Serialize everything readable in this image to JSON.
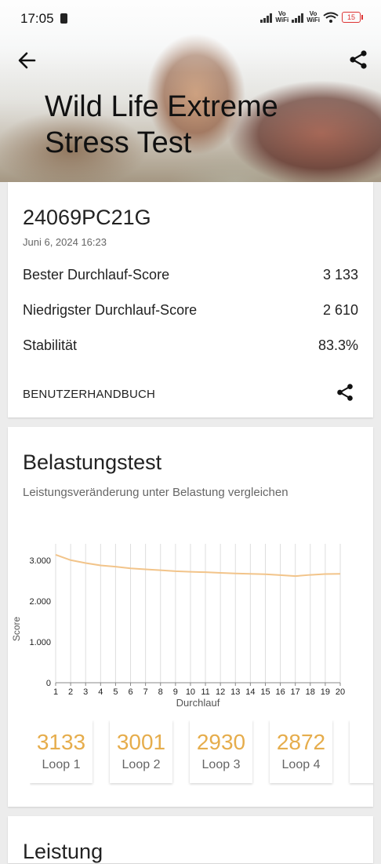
{
  "status": {
    "time": "17:05",
    "vo1": "Vo",
    "wifi1": "WiFi",
    "vo2": "Vo",
    "wifi2": "WiFi",
    "battery": "15"
  },
  "header": {
    "title": "Wild Life Extreme Stress Test"
  },
  "summary": {
    "device": "24069PC21G",
    "date": "Juni 6, 2024 16:23",
    "rows": [
      {
        "label": "Bester Durchlauf-Score",
        "value": "3 133"
      },
      {
        "label": "Niedrigster Durchlauf-Score",
        "value": "2 610"
      },
      {
        "label": "Stabilität",
        "value": "83.3%"
      }
    ],
    "manual": "BENUTZERHANDBUCH"
  },
  "stress": {
    "title": "Belastungstest",
    "subtitle": "Leistungsveränderung unter Belastung vergleichen"
  },
  "chart_data": {
    "type": "line",
    "xlabel": "Durchlauf",
    "ylabel": "Score",
    "x": [
      1,
      2,
      3,
      4,
      5,
      6,
      7,
      8,
      9,
      10,
      11,
      12,
      13,
      14,
      15,
      16,
      17,
      18,
      19,
      20
    ],
    "y_ticks": [
      "0",
      "1.000",
      "2.000",
      "3.000"
    ],
    "ylim": [
      0,
      3400
    ],
    "grid": "vertical",
    "color": "#f2c48a",
    "series": [
      {
        "values": [
          3133,
          3001,
          2930,
          2872,
          2840,
          2800,
          2775,
          2755,
          2730,
          2715,
          2705,
          2690,
          2675,
          2665,
          2655,
          2635,
          2610,
          2640,
          2660,
          2665
        ]
      }
    ]
  },
  "loops": [
    {
      "value": "3133",
      "label": "Loop 1"
    },
    {
      "value": "3001",
      "label": "Loop 2"
    },
    {
      "value": "2930",
      "label": "Loop 3"
    },
    {
      "value": "2872",
      "label": "Loop 4"
    }
  ],
  "next_section": {
    "title": "Leistung"
  },
  "colors": {
    "accent": "#e6ad4c",
    "line": "#f2c48a"
  }
}
